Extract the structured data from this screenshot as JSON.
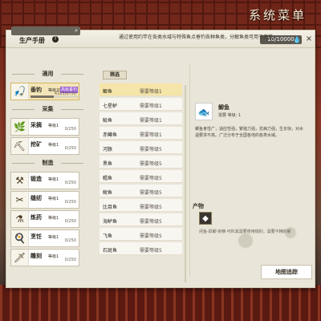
{
  "header": {
    "system_menu": "系统菜单",
    "title": "生产手册",
    "help": "?",
    "counter": "10/10000",
    "close": "×"
  },
  "left": {
    "sections": [
      "適用",
      "采集",
      "制造"
    ],
    "cards": [
      {
        "name": "垂钓",
        "level": "等级20",
        "tag": "高级垂钓",
        "progress_text": "4325/8750",
        "progress": 0.494,
        "icon": "fishing-icon",
        "selected": true
      },
      {
        "name": "采摘",
        "level": "等级1",
        "progress_text": "0/250",
        "progress": 0,
        "icon": "picking-icon"
      },
      {
        "name": "挖矿",
        "level": "等级1",
        "progress_text": "0/250",
        "progress": 0,
        "icon": "mining-icon"
      },
      {
        "name": "锻造",
        "level": "等级1",
        "progress_text": "0/250",
        "progress": 0,
        "icon": "forging-icon"
      },
      {
        "name": "缝纫",
        "level": "等级1",
        "progress_text": "0/250",
        "progress": 0,
        "icon": "sewing-icon"
      },
      {
        "name": "炼药",
        "level": "等级1",
        "progress_text": "0/250",
        "progress": 0,
        "icon": "alchemy-icon"
      },
      {
        "name": "烹饪",
        "level": "等级1",
        "progress_text": "0/250",
        "progress": 0,
        "icon": "cooking-icon"
      },
      {
        "name": "雕刻",
        "level": "等级1",
        "progress_text": "0/250",
        "progress": 0,
        "icon": "carving-icon"
      }
    ]
  },
  "banner": "通过使用约竿在各类水域与特殊鱼点垂钓各种鱼类，分解鱼类可用于烹饪。",
  "filter_tab": "筛选",
  "list": [
    {
      "name": "鲫鱼",
      "req": "需要等级1",
      "selected": true
    },
    {
      "name": "七星鲈",
      "req": "需要等级1"
    },
    {
      "name": "鲶鱼",
      "req": "需要等级1"
    },
    {
      "name": "赤鳟鱼",
      "req": "需要等级1"
    },
    {
      "name": "河豚",
      "req": "需要等级5"
    },
    {
      "name": "黑鱼",
      "req": "需要等级5"
    },
    {
      "name": "鳕鱼",
      "req": "需要等级5"
    },
    {
      "name": "鲵鱼",
      "req": "需要等级5"
    },
    {
      "name": "比目鱼",
      "req": "需要等级5"
    },
    {
      "name": "海鲈鱼",
      "req": "需要等级5"
    },
    {
      "name": "飞鱼",
      "req": "需要等级5"
    },
    {
      "name": "石斑鱼",
      "req": "需要等级5"
    }
  ],
  "detail": {
    "name": "鲫鱼",
    "meta": "需要 等级: 1",
    "desc": "鲫鱼食性广，适应性强，繁殖力强，抗病力强，生长快，对水温要求不高。广泛分布于全国各地的各类水域。",
    "product_label": "产物",
    "product_text": "闲鱼·跃鲫·亲精·可料其需要使用锅的，需要不精的新",
    "map_button": "地图追踪"
  }
}
